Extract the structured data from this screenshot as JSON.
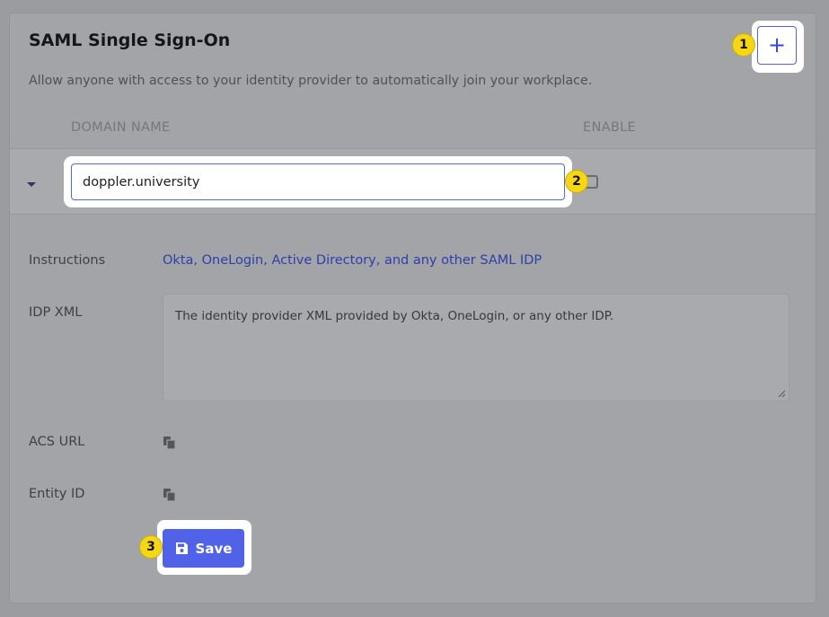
{
  "page": {
    "title": "SAML Single Sign-On",
    "subtitle": "Allow anyone with access to your identity provider to automatically join your workplace."
  },
  "table": {
    "columns": [
      "DOMAIN NAME",
      "ENABLE"
    ],
    "row": {
      "domain": "doppler.university",
      "enabled": false
    }
  },
  "details": {
    "instructions_label": "Instructions",
    "instructions_link": "Okta, OneLogin, Active Directory, and any other SAML IDP",
    "idp_xml_label": "IDP XML",
    "idp_xml_placeholder": "The identity provider XML provided by Okta, OneLogin, or any other IDP.",
    "acs_url_label": "ACS URL",
    "entity_id_label": "Entity ID"
  },
  "actions": {
    "add_label": "+",
    "save_label": "Save"
  },
  "annotations": [
    "1",
    "2",
    "3"
  ],
  "icons": {
    "expand": "caret-down-icon",
    "copy": "copy-icon",
    "save": "floppy-disk-icon",
    "add": "plus-icon"
  },
  "colors": {
    "accent": "#4f62e8",
    "link": "#2f3fa8",
    "badge": "#f7d714",
    "overlay_background": "#9b9ca0"
  }
}
